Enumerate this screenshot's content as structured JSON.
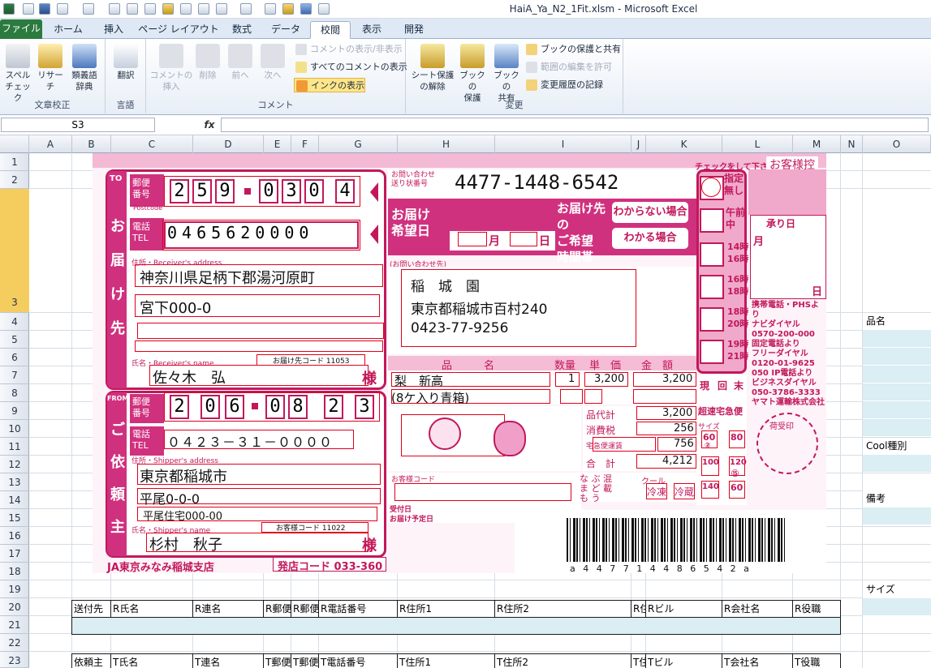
{
  "window_title": "HaiA_Ya_N2_1Fit.xlsm - Microsoft Excel",
  "tabs": [
    "ファイル",
    "ホーム",
    "挿入",
    "ページ レイアウト",
    "数式",
    "データ",
    "校閲",
    "表示",
    "開発"
  ],
  "active_tab": "校閲",
  "ribbon": {
    "proofing": {
      "label": "文章校正",
      "spell": "スペル\nチェック",
      "research": "リサーチ",
      "thesaurus": "類義語\n辞典"
    },
    "language": {
      "label": "言語",
      "translate": "翻訳"
    },
    "comments": {
      "label": "コメント",
      "insert": "コメントの\n挿入",
      "delete": "削除",
      "prev": "前へ",
      "next": "次へ",
      "show_hide": "コメントの表示/非表示",
      "show_all": "すべてのコメントの表示",
      "ink": "インクの表示"
    },
    "changes": {
      "label": "変更",
      "unprotect": "シート保護\nの解除",
      "protect_book": "ブックの\n保護",
      "share_book": "ブックの\n共有",
      "protect_share": "ブックの保護と共有",
      "allow_edit": "範囲の編集を許可",
      "track": "変更履歴の記録"
    }
  },
  "name_box": "S3",
  "fx": "fx",
  "columns": [
    "A",
    "B",
    "C",
    "D",
    "E",
    "F",
    "G",
    "H",
    "I",
    "J",
    "K",
    "L",
    "M",
    "N",
    "O"
  ],
  "rows": [
    "1",
    "2",
    "3",
    "4",
    "5",
    "6",
    "7",
    "8",
    "9",
    "10",
    "11",
    "12",
    "13",
    "14",
    "15",
    "16",
    "17",
    "18",
    "19",
    "20",
    "21",
    "22",
    "23"
  ],
  "side_labels": {
    "hinmei": "品名",
    "cool": "Cool種別",
    "bikou": "備考",
    "size": "サイズ"
  },
  "table_row20": [
    "送付先",
    "R氏名",
    "R連名",
    "R郵便",
    "R郵便",
    "R電話番号",
    "R住所1",
    "R住所2",
    "R住",
    "Rビル",
    "R会社名",
    "R役職"
  ],
  "table_row23": [
    "依頼主",
    "T氏名",
    "T連名",
    "T郵便",
    "T郵便",
    "T電話番号",
    "T住所1",
    "T住所2",
    "T住",
    "Tビル",
    "T会社名",
    "T役職"
  ],
  "slip": {
    "top_note": "お客様控",
    "check_note": "チェックをして下さい。",
    "to_label": "TO",
    "from_label": "FROM",
    "zip_label": "郵便\n番号",
    "postcode": "Postcode",
    "tel_label": "電話\nTEL",
    "to_vertical": "お届け先",
    "from_vertical": "ご依頼主",
    "to_zip": [
      "2",
      "5",
      "9",
      "0",
      "3",
      "0",
      "4"
    ],
    "to_tel": [
      "0",
      "4",
      "6",
      "5",
      "6",
      "2",
      "0",
      "0",
      "0",
      "0"
    ],
    "tracking_label": "お問い合わせ\n送り状番号",
    "tracking": "4477-1448-6542",
    "delivery_date_label": "お届け\n希望日",
    "month": "月",
    "day": "日",
    "time_label": "お届け先の\nご希望\n時間帯",
    "unknown": "わからない場合",
    "known": "わかる場合",
    "times": [
      "指定\n無し",
      "午前\n中",
      "14時\n16時",
      "16時\n18時",
      "18時\n20時",
      "19時\n21時"
    ],
    "receiver_addr_label": "住所・Receiver's address",
    "to_addr1": "神奈川県足柄下郡湯河原町",
    "to_addr2": "宮下000-0",
    "receiver_name_label": "氏名・Receiver's name",
    "to_code": "お届け先コード 11053",
    "to_name": "佐々木　弘",
    "sama": "様",
    "inquiry_label": "(お問い合わせ先)",
    "inquiry_name": "稲　城　園",
    "inquiry_addr": "東京都稲城市百村240",
    "inquiry_tel": "0423-77-9256",
    "item_head": "品　　　名",
    "qty_head": "数量",
    "price_head": "単　価",
    "amount_head": "金　額",
    "item1": "梨　新高",
    "item2": "(8ケ入り青箱)",
    "qty": "1",
    "price": "3,200",
    "amount": "3,200",
    "subtotal_label": "品代計",
    "subtotal": "3,200",
    "tax_label": "消費税",
    "tax": "256",
    "shipping_label": "宅急便運賃",
    "shipping": "756",
    "total_label": "合　計",
    "total": "4,212",
    "cool_label": "クール",
    "cool_types": [
      "冷凍",
      "冷蔵"
    ],
    "fragile": "な ぶ 混\nま ど 載\nも う",
    "express_label": "超速宅急便",
    "size_label": "サイズ",
    "sizes": [
      "60",
      "80",
      "100",
      "120",
      "140",
      "60"
    ],
    "size_sub": [
      "②",
      "⑮"
    ],
    "genkinri": [
      "現",
      "回",
      "末"
    ],
    "from_zip": [
      "2",
      "0",
      "6",
      "0",
      "8",
      "2",
      "3"
    ],
    "from_tel": "０４２３－３１－００００",
    "shipper_addr_label": "住所・Shipper's address",
    "from_addr1": "東京都稲城市",
    "from_addr2": "平尾0-0-0",
    "from_addr3": "平尾住宅000-00",
    "shipper_name_label": "氏名・Shipper's name",
    "from_code": "お客様コード 11022",
    "from_name": "杉村　秋子",
    "customer_code": "お客様コード",
    "received_date": "受付日",
    "planned_date": "お届け予定日",
    "receipt_label": "承り日",
    "receipt_month": "月",
    "receipt_day": "日",
    "stamp_label": "荷受印",
    "yamato_info": "携帯電話・PHSより\nナビダイヤル\n0570-200-000\n固定電話より\nフリーダイヤル\n0120-01-9625\n050 IP電話より\nビジネスダイヤル\n050-3786-3333\nヤマト運輸株式会社",
    "ja_branch": "JA東京みなみ稲城支店",
    "store_code": "発店コード 033-360",
    "barcode_text": "a 4 4 7 7 1 4 4 8 6 5 4 2 a"
  }
}
